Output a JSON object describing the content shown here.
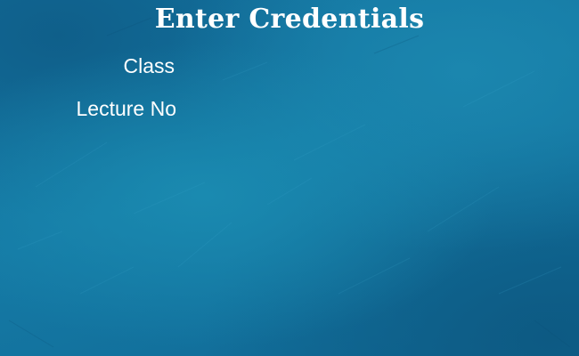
{
  "window": {
    "title": "Enter Credentials"
  },
  "form": {
    "class_label": "Class",
    "lecture_label": "Lecture No"
  },
  "colors": {
    "background": "#157aa5",
    "text": "#ffffff"
  }
}
